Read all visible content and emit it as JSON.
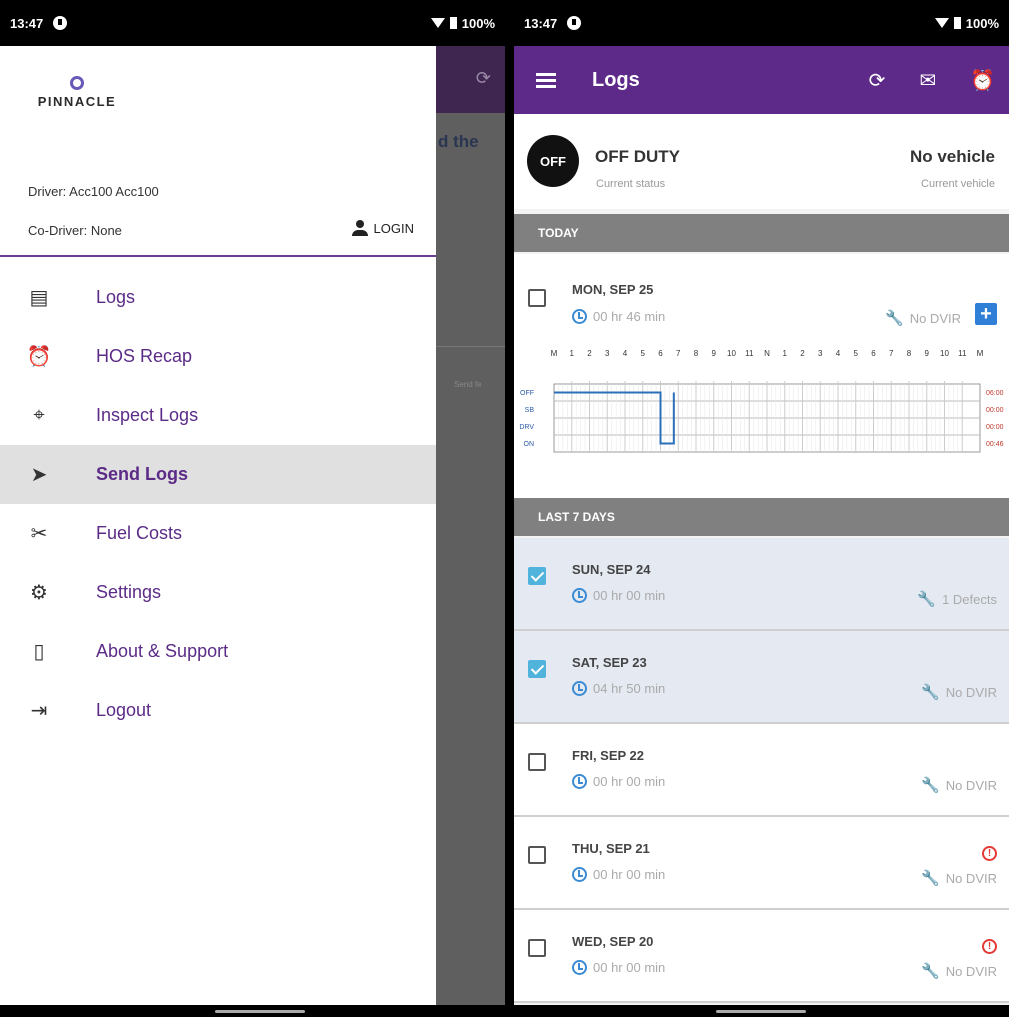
{
  "left": {
    "status": {
      "time": "13:47",
      "battery": "100%"
    },
    "scrim_text": "d the",
    "scrim_small": "Send fe",
    "logo_text": "PINNACLE",
    "driver": "Driver: Acc100 Acc100",
    "codriver": "Co-Driver: None",
    "login": "LOGIN",
    "menu": [
      {
        "label": "Logs",
        "icon": "log-icon"
      },
      {
        "label": "HOS Recap",
        "icon": "alarm-icon"
      },
      {
        "label": "Inspect Logs",
        "icon": "inspect-icon"
      },
      {
        "label": "Send Logs",
        "icon": "send-icon"
      },
      {
        "label": "Fuel Costs",
        "icon": "fuel-icon"
      },
      {
        "label": "Settings",
        "icon": "gear-icon"
      },
      {
        "label": "About & Support",
        "icon": "phone-icon"
      },
      {
        "label": "Logout",
        "icon": "logout-icon"
      }
    ]
  },
  "right": {
    "status": {
      "time": "13:47",
      "battery": "100%"
    },
    "appbar_title": "Logs",
    "off_badge": "OFF",
    "status_main": "OFF DUTY",
    "status_sub": "Current status",
    "vehicle_main": "No vehicle",
    "vehicle_sub": "Current vehicle",
    "today_header": "TODAY",
    "last7_header": "LAST 7 DAYS",
    "today": {
      "date": "MON, SEP 25",
      "time": "00 hr  46 min",
      "dvir": "No DVIR"
    },
    "graph": {
      "hours": [
        "M",
        "1",
        "2",
        "3",
        "4",
        "5",
        "6",
        "7",
        "8",
        "9",
        "10",
        "11",
        "N",
        "1",
        "2",
        "3",
        "4",
        "5",
        "6",
        "7",
        "8",
        "9",
        "10",
        "11",
        "M"
      ],
      "rows": [
        "OFF",
        "SB",
        "DRV",
        "ON"
      ],
      "totals": [
        "06:00",
        "00:00",
        "00:00",
        "00:46"
      ]
    },
    "days": [
      {
        "date": "SUN, SEP 24",
        "time": "00 hr  00 min",
        "dvir": "1 Defects",
        "checked": true,
        "warn": false
      },
      {
        "date": "SAT, SEP 23",
        "time": "04 hr  50 min",
        "dvir": "No DVIR",
        "checked": true,
        "warn": false
      },
      {
        "date": "FRI, SEP 22",
        "time": "00 hr  00 min",
        "dvir": "No DVIR",
        "checked": false,
        "warn": false
      },
      {
        "date": "THU, SEP 21",
        "time": "00 hr  00 min",
        "dvir": "No DVIR",
        "checked": false,
        "warn": true
      },
      {
        "date": "WED, SEP 20",
        "time": "00 hr  00 min",
        "dvir": "No DVIR",
        "checked": false,
        "warn": true
      }
    ]
  }
}
